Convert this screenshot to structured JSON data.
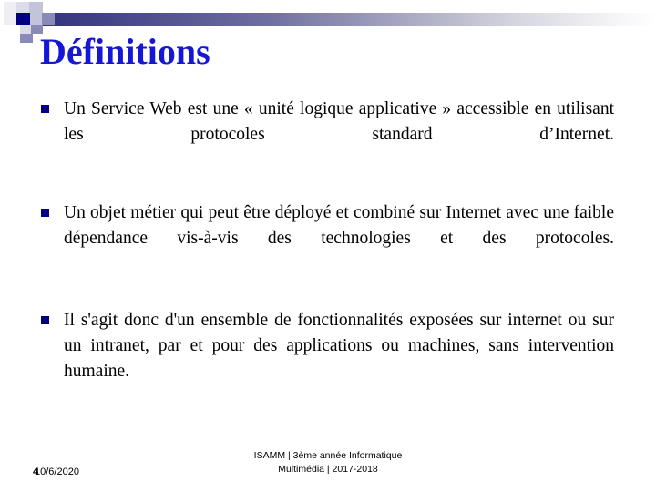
{
  "slide": {
    "title": "Définitions",
    "title_color": "#1616d6",
    "accent_color": "#000080",
    "background_color": "#ffffff",
    "band_gradient_from": "#2e2e7c",
    "band_gradient_to": "#ffffff"
  },
  "bullets": [
    {
      "marker": "square-bullet",
      "text": "Un Service Web est une « unité logique applicative » accessible en utilisant les protocoles standard d’Internet."
    },
    {
      "marker": "square-bullet",
      "text": "Un objet métier qui peut être déployé et combiné sur Internet avec une faible dépendance vis-à-vis des technologies et des protocoles."
    },
    {
      "marker": "square-bullet",
      "text": "Il s'agit donc d'un ensemble de fonctionnalités exposées sur internet ou sur un intranet, par et pour des applications ou machines, sans intervention humaine."
    }
  ],
  "footer": {
    "line1": "ISAMM | 3ème année Informatique",
    "line2": "Multimédia | 2017-2018",
    "date": "10/6/2020",
    "slide_number": "4"
  }
}
